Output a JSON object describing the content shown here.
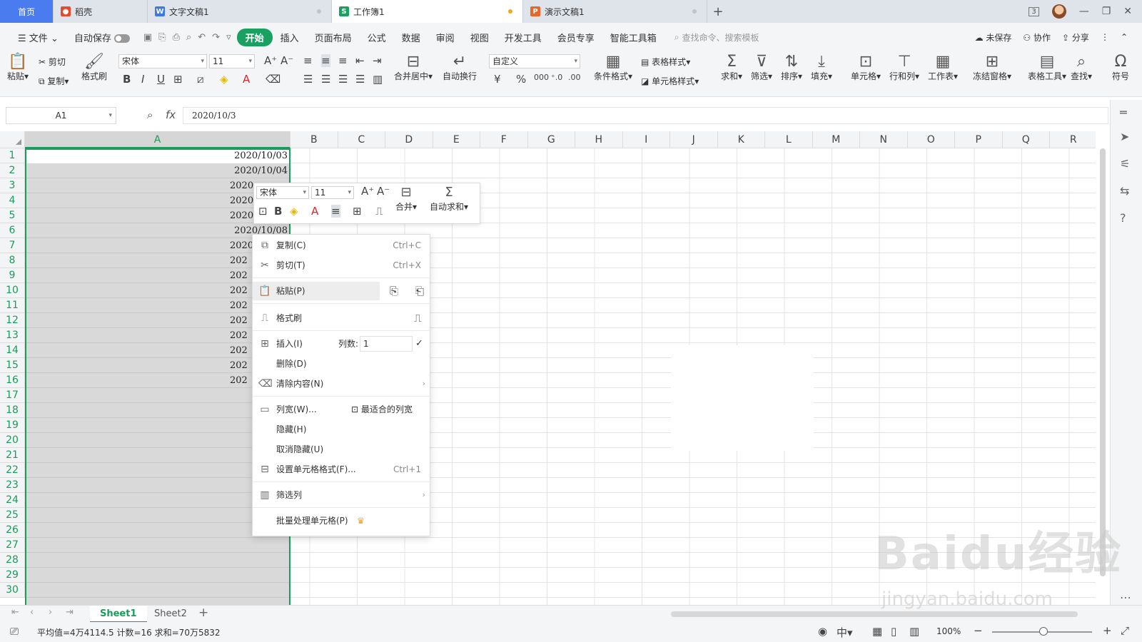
{
  "tabs": [
    {
      "label": "首页",
      "icon": ""
    },
    {
      "label": "稻壳",
      "icon": "docer-icon"
    },
    {
      "label": "文字文稿1",
      "icon": "word-icon"
    },
    {
      "label": "工作簿1",
      "icon": "sheet-icon"
    },
    {
      "label": "演示文稿1",
      "icon": "ppt-icon"
    }
  ],
  "tab_badge": "3",
  "menu": {
    "file": "文件",
    "autosave": "自动保存",
    "items": [
      "开始",
      "插入",
      "页面布局",
      "公式",
      "数据",
      "审阅",
      "视图",
      "开发工具",
      "会员专享",
      "智能工具箱"
    ],
    "search_placeholder": "查找命令、搜索模板",
    "unsaved": "未保存",
    "collab": "协作",
    "share": "分享"
  },
  "ribbon": {
    "paste": "粘贴",
    "cut": "剪切",
    "copy": "复制",
    "format_painter": "格式刷",
    "font_name": "宋体",
    "font_size": "11",
    "merge_center": "合并居中",
    "wrap": "自动换行",
    "number_format": "自定义",
    "cond_format": "条件格式",
    "table_style": "表格样式",
    "cell_style": "单元格样式",
    "sum": "求和",
    "filter": "筛选",
    "sort": "排序",
    "fill": "填充",
    "cell": "单元格",
    "rowcol": "行和列",
    "sheet": "工作表",
    "freeze": "冻结窗格",
    "table_tools": "表格工具",
    "find": "查找",
    "symbol": "符号"
  },
  "formula_bar": {
    "name_box": "A1",
    "fx": "fx",
    "value": "2020/10/3"
  },
  "columns": [
    "A",
    "B",
    "C",
    "D",
    "E",
    "F",
    "G",
    "H",
    "I",
    "J",
    "K",
    "L",
    "M",
    "N",
    "O",
    "P",
    "Q",
    "R"
  ],
  "rows": [
    "1",
    "2",
    "3",
    "4",
    "5",
    "6",
    "7",
    "8",
    "9",
    "10",
    "11",
    "12",
    "13",
    "14",
    "15",
    "16",
    "17",
    "18",
    "19",
    "20",
    "21",
    "22",
    "23",
    "24",
    "25",
    "26",
    "27",
    "28",
    "29",
    "30"
  ],
  "cells_full": [
    "2020/10/03",
    "2020/10/04"
  ],
  "cell_row6": "2020/10/08",
  "cells_partial": [
    "2020",
    "2020",
    "2020",
    "2020",
    "202",
    "202",
    "202",
    "202",
    "202",
    "202",
    "202",
    "202",
    "202",
    "202"
  ],
  "mini_toolbar": {
    "font": "宋体",
    "size": "11",
    "merge": "合并",
    "autosum": "自动求和"
  },
  "context_menu": {
    "copy": "复制(C)",
    "copy_sc": "Ctrl+C",
    "cut": "剪切(T)",
    "cut_sc": "Ctrl+X",
    "paste": "粘贴(P)",
    "format_painter": "格式刷",
    "insert": "插入(I)",
    "count_label": "列数:",
    "count_value": "1",
    "delete": "删除(D)",
    "clear": "清除内容(N)",
    "col_width": "列宽(W)...",
    "best_fit": "最适合的列宽",
    "hide": "隐藏(H)",
    "unhide": "取消隐藏(U)",
    "format_cells": "设置单元格格式(F)...",
    "format_sc": "Ctrl+1",
    "filter_col": "筛选列",
    "batch": "批量处理单元格(P)"
  },
  "sheets": [
    "Sheet1",
    "Sheet2"
  ],
  "status": {
    "summary": "平均值=4万4114.5  计数=16  求和=70万5832",
    "zoom": "100%"
  },
  "watermark": {
    "brand": "Baidu经验",
    "url": "jingyan.baidu.com"
  },
  "colors": {
    "accent": "#1aa161",
    "home_tab": "#4a7cf0",
    "selection": "#1a9c5c"
  }
}
